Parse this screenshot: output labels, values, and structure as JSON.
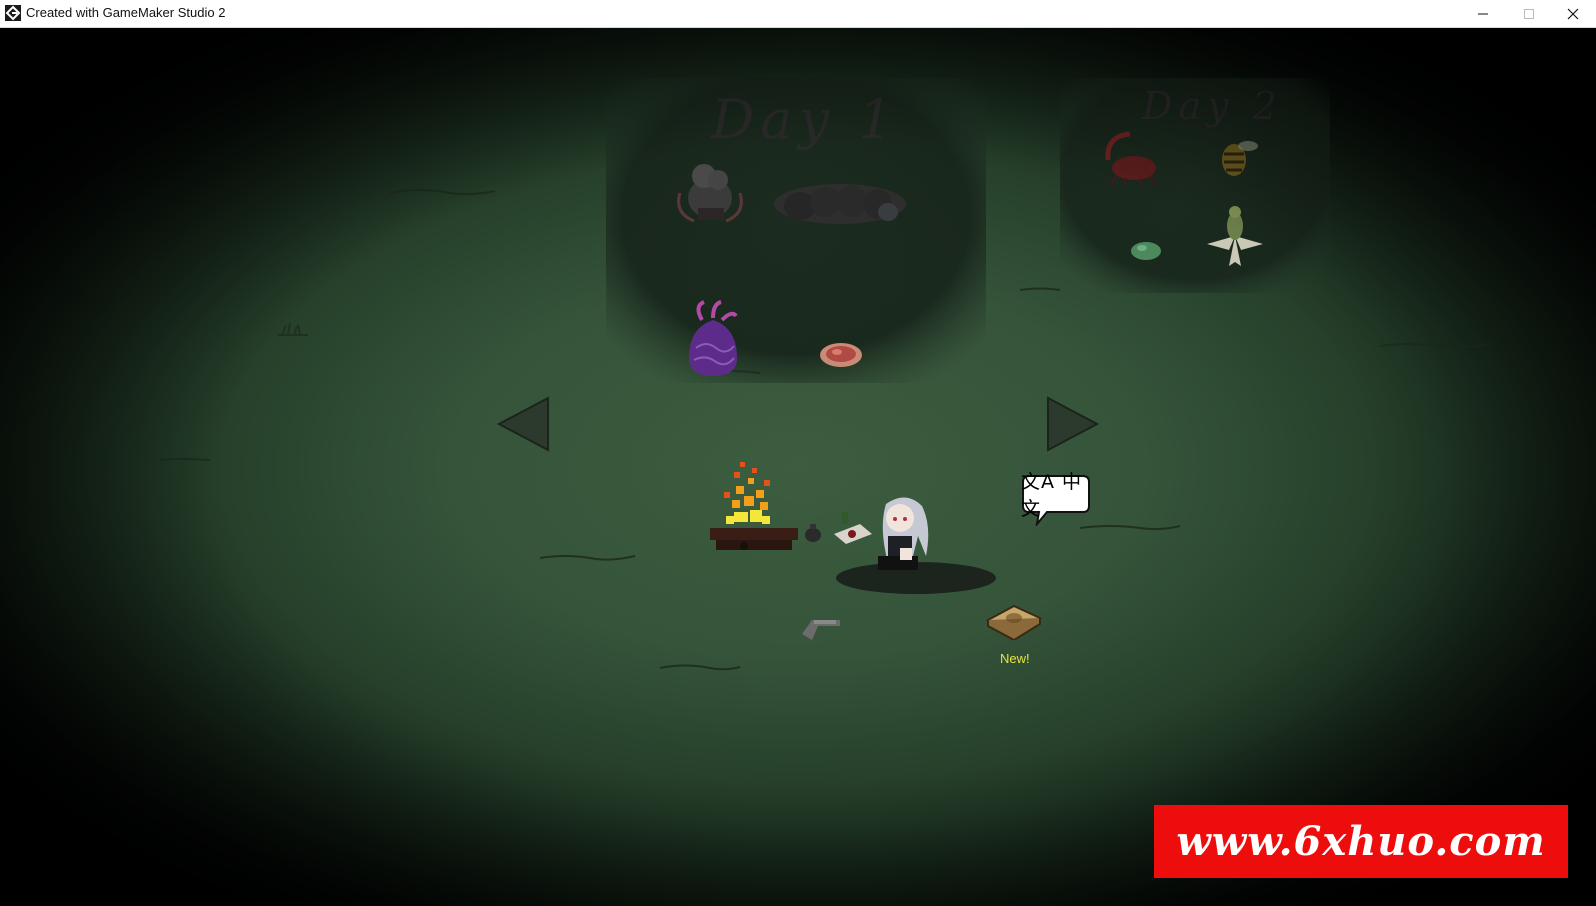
{
  "window": {
    "title": "Created with GameMaker Studio 2",
    "minimize_glyph": "—",
    "close_glyph": "✕"
  },
  "boards": [
    {
      "title": "Day 1",
      "items": [
        "grey-creature-icon",
        "grey-larva-icon",
        "purple-sack-icon",
        "raw-meat-icon"
      ]
    },
    {
      "title": "Day 2",
      "items": [
        "red-worm-icon",
        "wasp-icon",
        "green-slime-icon",
        "white-flower-icon"
      ]
    }
  ],
  "nav": {
    "prev": "◀",
    "next": "▶"
  },
  "language_bubble": {
    "label": "文A 中文"
  },
  "book": {
    "badge": "New!"
  },
  "watermark": {
    "text": "www.6xhuo.com"
  },
  "colors": {
    "grass": "#35543a",
    "new_badge": "#e6e53a",
    "watermark_bg": "#ee0d0d",
    "fire": "#f2a019"
  }
}
